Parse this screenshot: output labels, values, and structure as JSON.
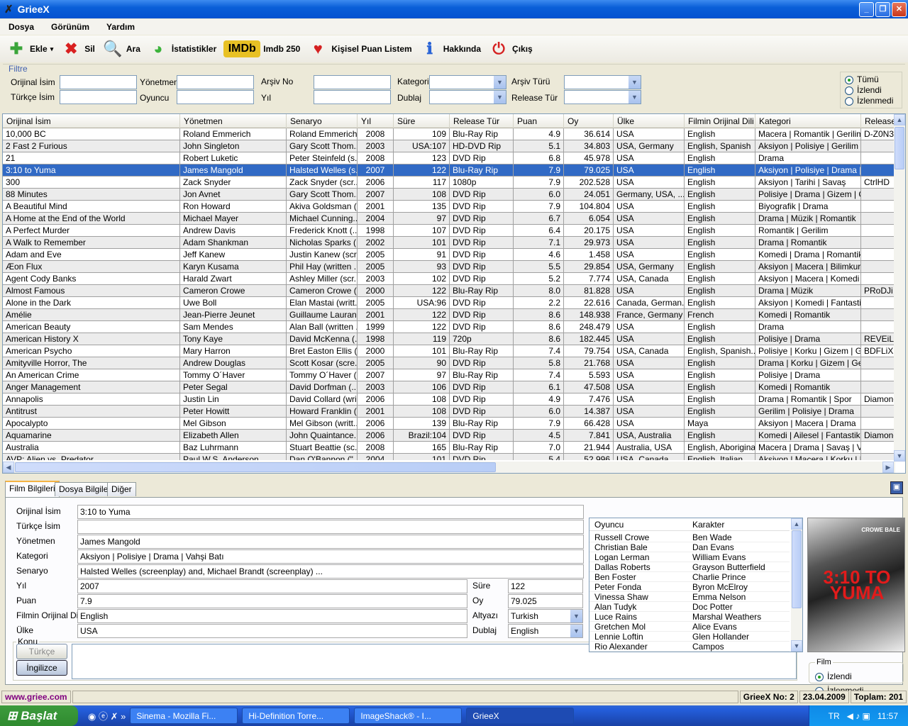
{
  "window": {
    "title": "GrieeX",
    "minimize": "_",
    "maximize": "❐",
    "close": "✕"
  },
  "menu": [
    "Dosya",
    "Görünüm",
    "Yardım"
  ],
  "toolbar": [
    {
      "label": "Ekle",
      "icon": "plus-icon",
      "glyph": "✚",
      "color": "#3aa53a",
      "dropdown": "▾"
    },
    {
      "label": "Sil",
      "icon": "delete-x-icon",
      "glyph": "✖",
      "color": "#d92020"
    },
    {
      "label": "Ara",
      "icon": "search-icon",
      "glyph": "🔍",
      "color": "#4a7ec0"
    },
    {
      "label": "İstatistikler",
      "icon": "pie-chart-icon",
      "glyph": "◕",
      "color": "#3cb33c"
    },
    {
      "label": "Imdb 250",
      "icon": "imdb-logo-icon",
      "glyph": "IMDb",
      "color": "#e8c125"
    },
    {
      "label": "Kişisel Puan Listem",
      "icon": "heart-icon",
      "glyph": "♥",
      "color": "#d52121"
    },
    {
      "label": "Hakkında",
      "icon": "info-icon",
      "glyph": "ℹ",
      "color": "#2a64d6"
    },
    {
      "label": "Çıkış",
      "icon": "power-icon",
      "glyph": "⏻",
      "color": "#d52121"
    }
  ],
  "filter": {
    "legend": "Filtre",
    "orijinal_isim": "Orijinal İsim",
    "turkce_isim": "Türkçe İsim",
    "yonetmen": "Yönetmen",
    "oyuncu": "Oyuncu",
    "arsiv_no": "Arşiv No",
    "yil": "Yıl",
    "kategori": "Kategori",
    "dublaj": "Dublaj",
    "arsiv_turu": "Arşiv Türü",
    "release_tur": "Release Tür",
    "radios": [
      {
        "label": "Tümü",
        "checked": true
      },
      {
        "label": "İzlendi",
        "checked": false
      },
      {
        "label": "İzlenmedi",
        "checked": false
      }
    ]
  },
  "grid": {
    "columns": [
      "Orijinal İsim",
      "Yönetmen",
      "Senaryo",
      "Yıl",
      "Süre",
      "Release Tür",
      "Puan",
      "Oy",
      "Ülke",
      "Filmin Orijinal Dili",
      "Kategori",
      "Release"
    ],
    "selected_index": 3,
    "rows": [
      [
        "10,000 BC",
        "Roland Emmerich",
        "Roland Emmerich...",
        "2008",
        "109",
        "Blu-Ray Rip",
        "4.9",
        "36.614",
        "USA",
        "English",
        "Macera | Romantik | Gerilim",
        "D-Z0N3"
      ],
      [
        "2 Fast 2 Furious",
        "John Singleton",
        "Gary Scott Thom...",
        "2003",
        "USA:107",
        "HD-DVD Rip",
        "5.1",
        "34.803",
        "USA, Germany",
        "English, Spanish",
        "Aksiyon | Polisiye | Gerilim",
        ""
      ],
      [
        "21",
        "Robert Luketic",
        "Peter Steinfeld (s...",
        "2008",
        "123",
        "DVD Rip",
        "6.8",
        "45.978",
        "USA",
        "English",
        "Drama",
        ""
      ],
      [
        "3:10 to Yuma",
        "James Mangold",
        "Halsted Welles (s...",
        "2007",
        "122",
        "Blu-Ray Rip",
        "7.9",
        "79.025",
        "USA",
        "English",
        "Aksiyon | Polisiye | Drama | ...",
        ""
      ],
      [
        "300",
        "Zack Snyder",
        "Zack Snyder (scr...",
        "2006",
        "117",
        "1080p",
        "7.9",
        "202.528",
        "USA",
        "English",
        "Aksiyon | Tarihi | Savaş",
        "CtrlHD"
      ],
      [
        "88 Minutes",
        "Jon Avnet",
        "Gary Scott Thom...",
        "2007",
        "108",
        "DVD Rip",
        "6.0",
        "24.051",
        "Germany, USA, ...",
        "English",
        "Polisiye | Drama | Gizem | Ge...",
        ""
      ],
      [
        "A Beautiful Mind",
        "Ron Howard",
        "Akiva Goldsman (...",
        "2001",
        "135",
        "DVD Rip",
        "7.9",
        "104.804",
        "USA",
        "English",
        "Biyografik | Drama",
        ""
      ],
      [
        "A Home at the End of the World",
        "Michael Mayer",
        "Michael Cunning...",
        "2004",
        "97",
        "DVD Rip",
        "6.7",
        "6.054",
        "USA",
        "English",
        "Drama | Müzik | Romantik",
        ""
      ],
      [
        "A Perfect Murder",
        "Andrew Davis",
        "Frederick Knott (...",
        "1998",
        "107",
        "DVD Rip",
        "6.4",
        "20.175",
        "USA",
        "English",
        "Romantik | Gerilim",
        ""
      ],
      [
        "A Walk to Remember",
        "Adam Shankman",
        "Nicholas Sparks (...",
        "2002",
        "101",
        "DVD Rip",
        "7.1",
        "29.973",
        "USA",
        "English",
        "Drama | Romantik",
        ""
      ],
      [
        "Adam and Eve",
        "Jeff Kanew",
        "Justin Kanew (scr...",
        "2005",
        "91",
        "DVD Rip",
        "4.6",
        "1.458",
        "USA",
        "English",
        "Komedi | Drama | Romantik",
        ""
      ],
      [
        "Æon Flux",
        "Karyn Kusama",
        "Phil Hay (written ...",
        "2005",
        "93",
        "DVD Rip",
        "5.5",
        "29.854",
        "USA, Germany",
        "English",
        "Aksiyon | Macera | Bilimkurg...",
        ""
      ],
      [
        "Agent Cody Banks",
        "Harald Zwart",
        "Ashley Miller (scr...",
        "2003",
        "102",
        "DVD Rip",
        "5.2",
        "7.774",
        "USA, Canada",
        "English",
        "Aksiyon | Macera | Komedi | ...",
        ""
      ],
      [
        "Almost Famous",
        "Cameron Crowe",
        "Cameron Crowe (...",
        "2000",
        "122",
        "Blu-Ray Rip",
        "8.0",
        "81.828",
        "USA",
        "English",
        "Drama | Müzik",
        "PRoDJi"
      ],
      [
        "Alone in the Dark",
        "Uwe Boll",
        "Elan Mastai (writt...",
        "2005",
        "USA:96",
        "DVD Rip",
        "2.2",
        "22.616",
        "Canada, German...",
        "English",
        "Aksiyon | Komedi | Fantastik...",
        ""
      ],
      [
        "Amélie",
        "Jean-Pierre Jeunet",
        "Guillaume Lauran...",
        "2001",
        "122",
        "DVD Rip",
        "8.6",
        "148.938",
        "France, Germany",
        "French",
        "Komedi | Romantik",
        ""
      ],
      [
        "American Beauty",
        "Sam Mendes",
        "Alan Ball (written ...",
        "1999",
        "122",
        "DVD Rip",
        "8.6",
        "248.479",
        "USA",
        "English",
        "Drama",
        ""
      ],
      [
        "American History X",
        "Tony Kaye",
        "David McKenna (...",
        "1998",
        "119",
        "720p",
        "8.6",
        "182.445",
        "USA",
        "English",
        "Polisiye | Drama",
        "REVEiLL"
      ],
      [
        "American Psycho",
        "Mary Harron",
        "Bret Easton Ellis (...",
        "2000",
        "101",
        "Blu-Ray Rip",
        "7.4",
        "79.754",
        "USA, Canada",
        "English, Spanish...",
        "Polisiye | Korku | Gizem | Ger...",
        "BDFLiX"
      ],
      [
        "Amityville Horror, The",
        "Andrew Douglas",
        "Scott Kosar (scre...",
        "2005",
        "90",
        "DVD Rip",
        "5.8",
        "21.768",
        "USA",
        "English",
        "Drama | Korku | Gizem | Geril...",
        ""
      ],
      [
        "An American Crime",
        "Tommy O´Haver",
        "Tommy O´Haver (...",
        "2007",
        "97",
        "Blu-Ray Rip",
        "7.4",
        "5.593",
        "USA",
        "English",
        "Polisiye | Drama",
        ""
      ],
      [
        "Anger Management",
        "Peter Segal",
        "David Dorfman (...",
        "2003",
        "106",
        "DVD Rip",
        "6.1",
        "47.508",
        "USA",
        "English",
        "Komedi | Romantik",
        ""
      ],
      [
        "Annapolis",
        "Justin Lin",
        "David Collard (wri...",
        "2006",
        "108",
        "DVD Rip",
        "4.9",
        "7.476",
        "USA",
        "English",
        "Drama | Romantik | Spor",
        "Diamond"
      ],
      [
        "Antitrust",
        "Peter Howitt",
        "Howard Franklin (...",
        "2001",
        "108",
        "DVD Rip",
        "6.0",
        "14.387",
        "USA",
        "English",
        "Gerilim | Polisiye | Drama",
        ""
      ],
      [
        "Apocalypto",
        "Mel Gibson",
        "Mel Gibson (writt...",
        "2006",
        "139",
        "Blu-Ray Rip",
        "7.9",
        "66.428",
        "USA",
        "Maya",
        "Aksiyon | Macera | Drama",
        ""
      ],
      [
        "Aquamarine",
        "Elizabeth Allen",
        "John Quaintance...",
        "2006",
        "Brazil:104",
        "DVD Rip",
        "4.5",
        "7.841",
        "USA, Australia",
        "English",
        "Komedi | Ailesel | Fantastik | ...",
        "Diamond"
      ],
      [
        "Australia",
        "Baz Luhrmann",
        "Stuart Beattie (sc...",
        "2008",
        "165",
        "Blu-Ray Rip",
        "7.0",
        "21.944",
        "Australia, USA",
        "English, Aboriginal",
        "Macera | Drama | Savaş | V...",
        ""
      ],
      [
        "AVP: Alien vs. Predator",
        "Paul W.S. Anderson",
        "Dan O'Bannon (\"...",
        "2004",
        "101",
        "DVD Rip",
        "5.4",
        "52.996",
        "USA, Canada, ...",
        "English, Italian",
        "Aksiyon | Macera | Korku | B...",
        ""
      ]
    ]
  },
  "detail": {
    "tabs": [
      "Film Bilgileri",
      "Dosya Bilgileri",
      "Diğer"
    ],
    "fields": {
      "orijinal_isim": {
        "label": "Orijinal İsim",
        "value": "3:10 to Yuma"
      },
      "turkce_isim": {
        "label": "Türkçe İsim",
        "value": ""
      },
      "yonetmen": {
        "label": "Yönetmen",
        "value": "James Mangold"
      },
      "kategori": {
        "label": "Kategori",
        "value": "Aksiyon | Polisiye | Drama | Vahşi Batı"
      },
      "senaryo": {
        "label": "Senaryo",
        "value": "Halsted Welles (screenplay) and, Michael Brandt (screenplay) ..."
      },
      "yil": {
        "label": "Yıl",
        "value": "2007"
      },
      "puan": {
        "label": "Puan",
        "value": "7.9"
      },
      "dil": {
        "label": "Filmin Orijinal Dili",
        "value": "English"
      },
      "ulke": {
        "label": "Ülke",
        "value": "USA"
      },
      "sure": {
        "label": "Süre",
        "value": "122"
      },
      "oy": {
        "label": "Oy",
        "value": "79.025"
      },
      "altyazi": {
        "label": "Altyazı",
        "value": "Turkish"
      },
      "dublaj": {
        "label": "Dublaj",
        "value": "English"
      }
    },
    "konu": {
      "legend": "Konu",
      "turkce": "Türkçe",
      "ingilizce": "İngilizce",
      "text": ""
    },
    "cast_headers": [
      "Oyuncu",
      "Karakter"
    ],
    "cast": [
      [
        "Russell Crowe",
        "Ben Wade"
      ],
      [
        "Christian Bale",
        "Dan Evans"
      ],
      [
        "Logan Lerman",
        "William Evans"
      ],
      [
        "Dallas Roberts",
        "Grayson Butterfield"
      ],
      [
        "Ben Foster",
        "Charlie Prince"
      ],
      [
        "Peter Fonda",
        "Byron McElroy"
      ],
      [
        "Vinessa Shaw",
        "Emma Nelson"
      ],
      [
        "Alan Tudyk",
        "Doc Potter"
      ],
      [
        "Luce Rains",
        "Marshal Weathers"
      ],
      [
        "Gretchen Mol",
        "Alice Evans"
      ],
      [
        "Lennie Loftin",
        "Glen Hollander"
      ],
      [
        "Rio Alexander",
        "Campos"
      ]
    ],
    "poster": {
      "title": "3:10 TO YUMA",
      "names": "CROWE BALE"
    },
    "film_status": {
      "legend": "Film",
      "options": [
        {
          "label": "İzlendi",
          "checked": true
        },
        {
          "label": "İzlenmedi",
          "checked": false
        }
      ]
    }
  },
  "status": {
    "site": "www.griee.com",
    "no": "GrieeX No: 2",
    "date": "23.04.2009",
    "total": "Toplam: 201"
  },
  "taskbar": {
    "start": "Başlat",
    "tasks": [
      "Sinema - Mozilla Fi...",
      "Hi-Definition Torre...",
      "ImageShack® - I...",
      "GrieeX"
    ],
    "lang": "TR",
    "clock": "11:57"
  }
}
